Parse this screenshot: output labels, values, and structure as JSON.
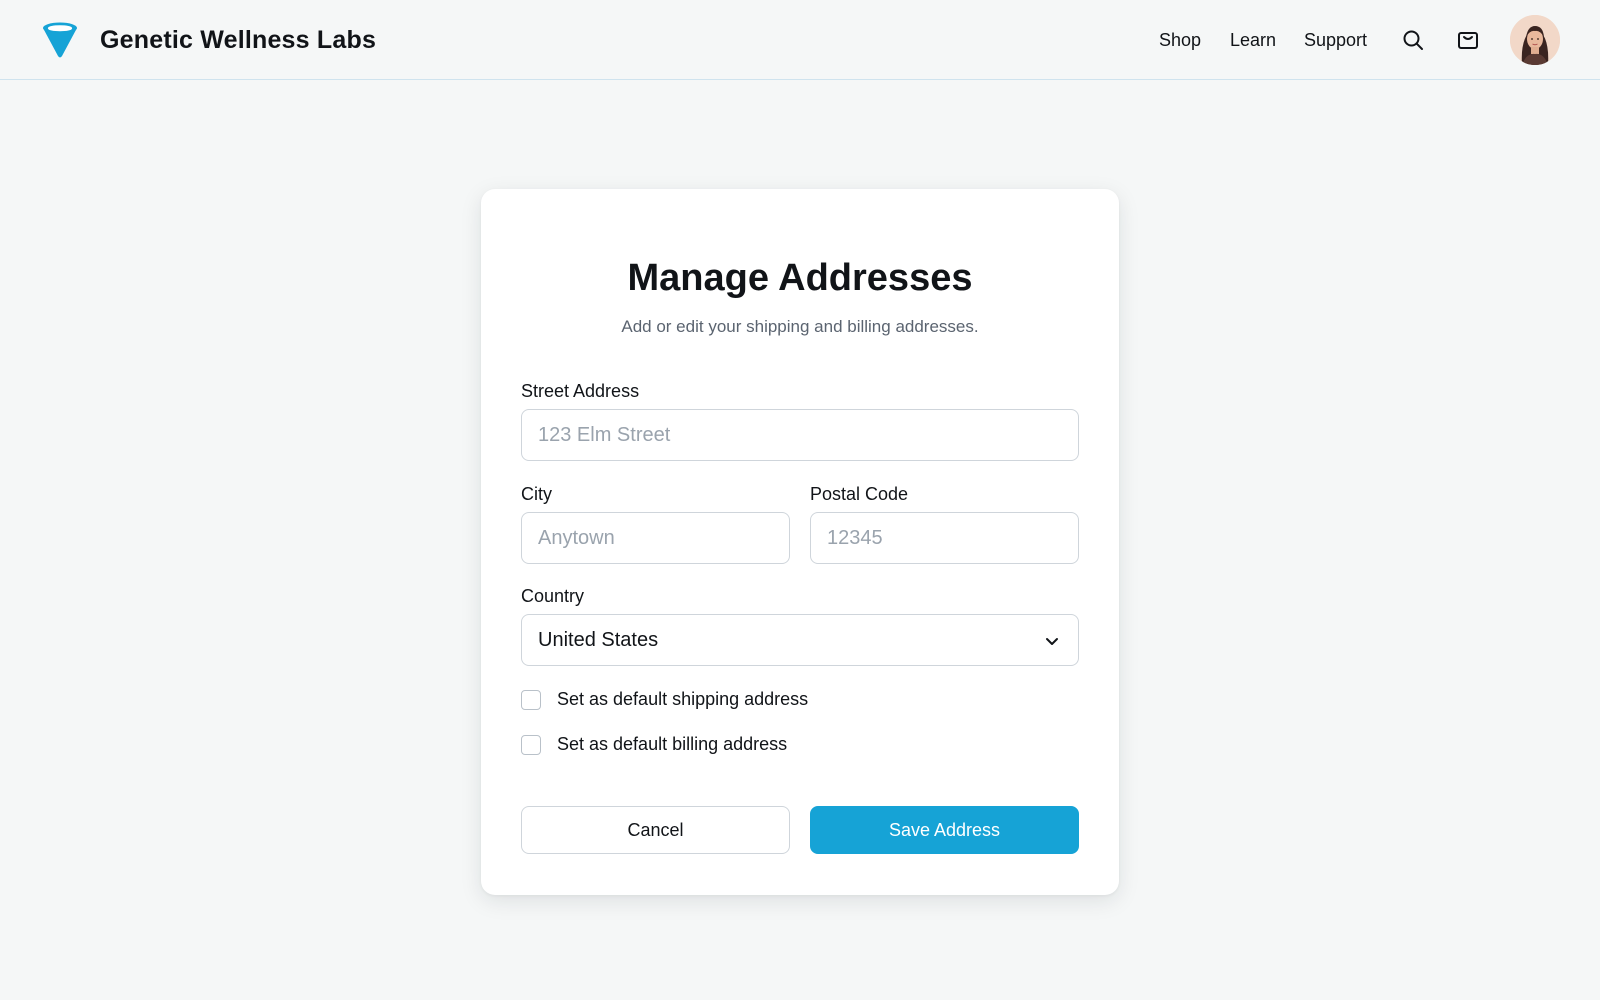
{
  "brand": {
    "name": "Genetic Wellness Labs",
    "logo_icon": "funnel-logo-icon",
    "accent": "#16a3d6"
  },
  "nav": {
    "items": [
      {
        "label": "Shop"
      },
      {
        "label": "Learn"
      },
      {
        "label": "Support"
      }
    ],
    "search_icon": "search-icon",
    "cart_icon": "cart-icon",
    "avatar": "user-avatar"
  },
  "form": {
    "title": "Manage Addresses",
    "subtitle": "Add or edit your shipping and billing addresses.",
    "street": {
      "label": "Street Address",
      "placeholder": "123 Elm Street",
      "value": ""
    },
    "city": {
      "label": "City",
      "placeholder": "Anytown",
      "value": ""
    },
    "postal": {
      "label": "Postal Code",
      "placeholder": "12345",
      "value": ""
    },
    "country": {
      "label": "Country",
      "value": "United States"
    },
    "default_shipping": {
      "label": "Set as default shipping address",
      "checked": false
    },
    "default_billing": {
      "label": "Set as default billing address",
      "checked": false
    },
    "cancel_label": "Cancel",
    "save_label": "Save Address"
  }
}
